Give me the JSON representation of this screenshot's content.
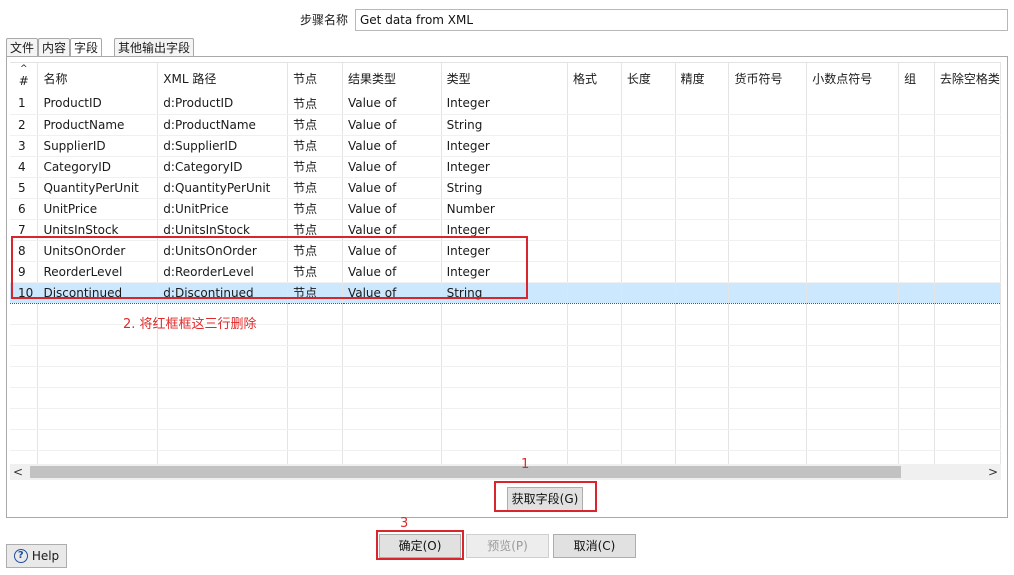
{
  "step": {
    "label": "步骤名称",
    "value": "Get data from XML"
  },
  "tabs": [
    {
      "label": "文件"
    },
    {
      "label": "内容"
    },
    {
      "label": "字段"
    },
    {
      "label": "其他输出字段"
    }
  ],
  "active_tab": "字段",
  "grid": {
    "headers": [
      "#",
      "名称",
      "XML 路径",
      "节点",
      "结果类型",
      "类型",
      "格式",
      "长度",
      "精度",
      "货币符号",
      "小数点符号",
      "组",
      "去除空格类"
    ],
    "sort_indicator": "^",
    "rows": [
      {
        "num": "1",
        "name": "ProductID",
        "path": "d:ProductID",
        "node": "节点",
        "result": "Value of",
        "type": "Integer"
      },
      {
        "num": "2",
        "name": "ProductName",
        "path": "d:ProductName",
        "node": "节点",
        "result": "Value of",
        "type": "String"
      },
      {
        "num": "3",
        "name": "SupplierID",
        "path": "d:SupplierID",
        "node": "节点",
        "result": "Value of",
        "type": "Integer"
      },
      {
        "num": "4",
        "name": "CategoryID",
        "path": "d:CategoryID",
        "node": "节点",
        "result": "Value of",
        "type": "Integer"
      },
      {
        "num": "5",
        "name": "QuantityPerUnit",
        "path": "d:QuantityPerUnit",
        "node": "节点",
        "result": "Value of",
        "type": "String"
      },
      {
        "num": "6",
        "name": "UnitPrice",
        "path": "d:UnitPrice",
        "node": "节点",
        "result": "Value of",
        "type": "Number"
      },
      {
        "num": "7",
        "name": "UnitsInStock",
        "path": "d:UnitsInStock",
        "node": "节点",
        "result": "Value of",
        "type": "Integer"
      },
      {
        "num": "8",
        "name": "UnitsOnOrder",
        "path": "d:UnitsOnOrder",
        "node": "节点",
        "result": "Value of",
        "type": "Integer"
      },
      {
        "num": "9",
        "name": "ReorderLevel",
        "path": "d:ReorderLevel",
        "node": "节点",
        "result": "Value of",
        "type": "Integer"
      },
      {
        "num": "10",
        "name": "Discontinued",
        "path": "d:Discontinued",
        "node": "节点",
        "result": "Value of",
        "type": "String"
      }
    ],
    "selected_row": "10"
  },
  "buttons": {
    "get_fields": "获取字段(G)",
    "ok": "确定(O)",
    "preview": "预览(P)",
    "cancel": "取消(C)",
    "help": "Help"
  },
  "annotations": {
    "note_delete": "2. 将红框框这三行删除",
    "marker_1": "1",
    "marker_3": "3"
  },
  "scrollbar": {
    "left_arrow": "<",
    "right_arrow": ">"
  },
  "colors": {
    "selection": "#cce8ff",
    "annotation_red": "#e02a2a",
    "help_icon": "#1f4f9e"
  },
  "icons": {
    "help": "help-circle-icon"
  }
}
